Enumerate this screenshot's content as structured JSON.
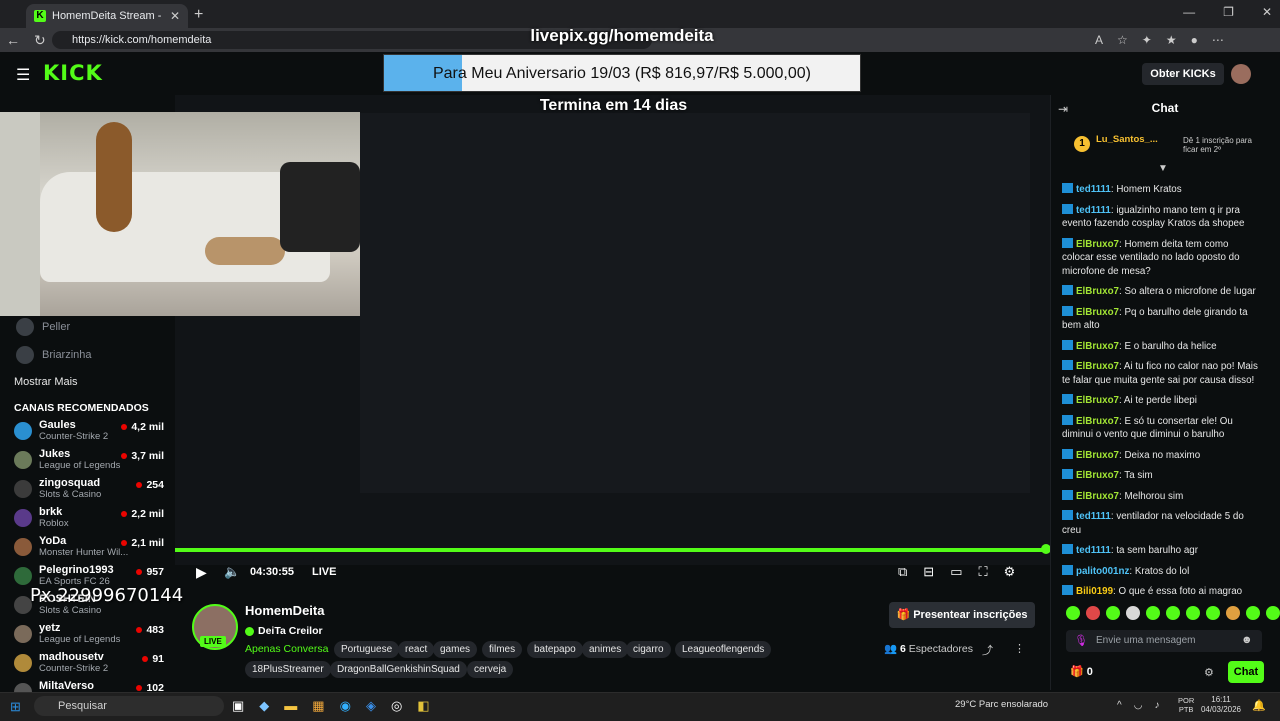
{
  "browser": {
    "tab_title": "HomemDeita Stream - Watch Live",
    "url": "https://kick.com/homemdeita"
  },
  "overlay": {
    "livepix_url": "livepix.gg/homemdeita",
    "goal_prefix": "Para",
    "goal_text": "Meu Aniversario 19/03 (R$ 816,97/R$ 5.000,00)",
    "goal_progress": 0.163,
    "goal_end": "Termina em 14 dias"
  },
  "header": {
    "logo": "KICK",
    "kicks_button": "Obter KICKs"
  },
  "sidebar": {
    "dim_items": [
      "Peller",
      "Briarzinha"
    ],
    "more": "Mostrar Mais",
    "recommended_title": "CANAIS RECOMENDADOS",
    "channels": [
      {
        "name": "Gaules",
        "game": "Counter-Strike 2",
        "viewers": "4,2 mil",
        "color": "#2a8fd0"
      },
      {
        "name": "Jukes",
        "game": "League of Legends",
        "viewers": "3,7 mil",
        "color": "#6b7a5a"
      },
      {
        "name": "zingosquad",
        "game": "Slots & Casino",
        "viewers": "254",
        "color": "#3b3b3b"
      },
      {
        "name": "brkk",
        "game": "Roblox",
        "viewers": "2,2 mil",
        "color": "#5a3a8a"
      },
      {
        "name": "YoDa",
        "game": "Monster Hunter Wil...",
        "viewers": "2,1 mil",
        "color": "#8a5a3a"
      },
      {
        "name": "Pelegrino1993",
        "game": "EA Sports FC 26",
        "viewers": "957",
        "color": "#2e6a3a"
      },
      {
        "name": "ROSHTEIN",
        "game": "Slots & Casino",
        "viewers": "",
        "color": "#444"
      },
      {
        "name": "yetz",
        "game": "League of Legends",
        "viewers": "483",
        "color": "#7a6a5a"
      },
      {
        "name": "madhousetv",
        "game": "Counter-Strike 2",
        "viewers": "91",
        "color": "#b08a3a"
      },
      {
        "name": "MiltaVerso",
        "game": "",
        "viewers": "102",
        "color": "#555"
      }
    ]
  },
  "player": {
    "time": "04:30:55",
    "live": "LIVE",
    "progress": 0.995
  },
  "px_overlay": "Px.22999670144",
  "stream": {
    "name": "HomemDeita",
    "subtitle": "DeiTa Creilor",
    "category": "Apenas Conversa",
    "live_badge": "LIVE",
    "tags": [
      "Portuguese",
      "react",
      "games",
      "filmes",
      "batepapo",
      "animes",
      "cigarro",
      "Leagueoflengends",
      "18PlusStreamer",
      "DragonBallGenkishinSquad",
      "cerveja"
    ],
    "present_button": "Presentear inscrições",
    "viewers_count": "6",
    "viewers_label": "Espectadores"
  },
  "chat": {
    "title": "Chat",
    "pinned_user": "Lu_Santos_...",
    "pinned_text": "Dê 1 inscrição para ficar em 2º",
    "messages": [
      {
        "user": "ted1111",
        "color": "#4fc3f7",
        "text": "Homem Kratos"
      },
      {
        "user": "ted1111",
        "color": "#4fc3f7",
        "text": "igualzinho mano tem q ir pra evento fazendo cosplay Kratos da shopee"
      },
      {
        "user": "ElBruxo7",
        "color": "#a3e635",
        "text": "Homem deita tem como colocar esse ventilado no lado oposto do microfone de mesa?"
      },
      {
        "user": "ElBruxo7",
        "color": "#a3e635",
        "text": "So altera o microfone de lugar"
      },
      {
        "user": "ElBruxo7",
        "color": "#a3e635",
        "text": "Pq o barulho dele girando ta bem alto"
      },
      {
        "user": "ElBruxo7",
        "color": "#a3e635",
        "text": "E o barulho da helice"
      },
      {
        "user": "ElBruxo7",
        "color": "#a3e635",
        "text": "Ai tu fico no calor nao po! Mais te falar que muita gente sai por causa disso!"
      },
      {
        "user": "ElBruxo7",
        "color": "#a3e635",
        "text": "Ai te perde libepi"
      },
      {
        "user": "ElBruxo7",
        "color": "#a3e635",
        "text": "E só tu consertar ele! Ou diminui o vento que diminui o barulho"
      },
      {
        "user": "ElBruxo7",
        "color": "#a3e635",
        "text": "Deixa no maximo"
      },
      {
        "user": "ElBruxo7",
        "color": "#a3e635",
        "text": "Ta sim"
      },
      {
        "user": "ElBruxo7",
        "color": "#a3e635",
        "text": "Melhorou sim"
      },
      {
        "user": "ted1111",
        "color": "#4fc3f7",
        "text": "ventilador na velocidade 5 do creu"
      },
      {
        "user": "ted1111",
        "color": "#4fc3f7",
        "text": "ta sem barulho agr"
      },
      {
        "user": "palito001nz",
        "color": "#4fc3f7",
        "text": "Kratos do lol"
      },
      {
        "user": "Bili0199",
        "color": "#facc15",
        "text": "O que é essa foto ai magrao"
      }
    ],
    "input_placeholder": "Envie uma mensagem",
    "points": "0",
    "chat_button": "Chat"
  },
  "taskbar": {
    "search": "Pesquisar",
    "weather": "29°C  Parc ensolarado",
    "lang_top": "POR",
    "lang_bottom": "PTB",
    "time": "16:11",
    "date": "04/03/2026"
  }
}
